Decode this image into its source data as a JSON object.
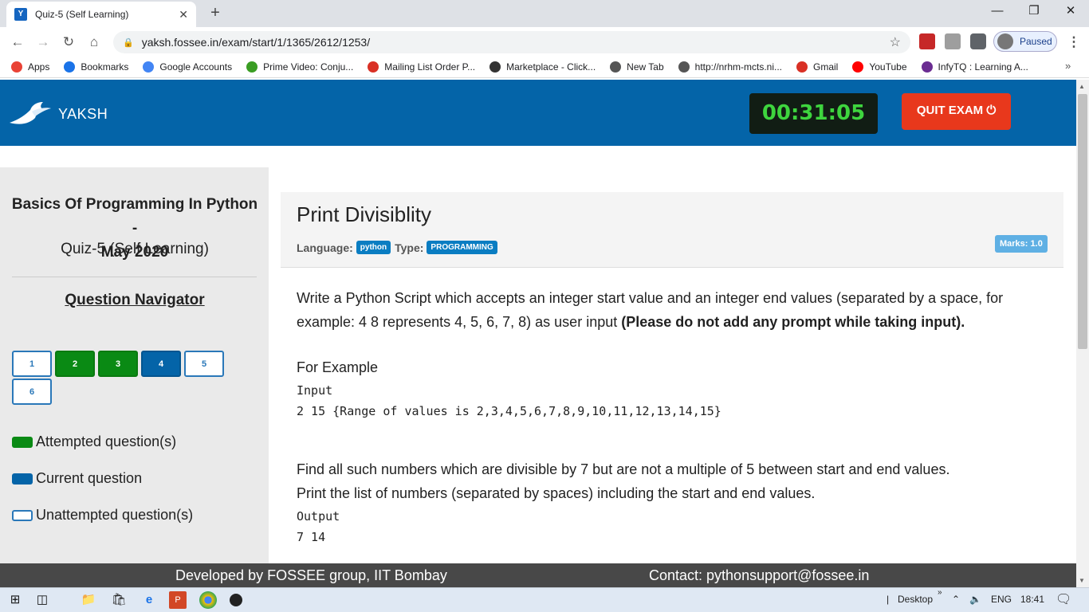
{
  "browser": {
    "tab_title": "Quiz-5 (Self Learning)",
    "tab_close": "✕",
    "new_tab": "+",
    "url": "yaksh.fossee.in/exam/start/1/1365/2612/1253/",
    "profile_status": "Paused",
    "bookmarks": [
      {
        "label": "Apps",
        "color": "#e94235"
      },
      {
        "label": "Bookmarks",
        "color": "#1a73e8"
      },
      {
        "label": "Google Accounts",
        "color": "#4285f4"
      },
      {
        "label": "Prime Video: Conju...",
        "color": "#3a9d23"
      },
      {
        "label": "Mailing List Order P...",
        "color": "#d93025"
      },
      {
        "label": "Marketplace - Click...",
        "color": "#333333"
      },
      {
        "label": "New Tab",
        "color": "#555555"
      },
      {
        "label": "http://nrhm-mcts.ni...",
        "color": "#555555"
      },
      {
        "label": "Gmail",
        "color": "#d93025"
      },
      {
        "label": "YouTube",
        "color": "#ff0000"
      },
      {
        "label": "InfyTQ : Learning A...",
        "color": "#6a2c91"
      }
    ]
  },
  "header": {
    "brand": "YAKSH",
    "timer": "00:31:05",
    "quit_label": "QUIT EXAM ⏻"
  },
  "sidebar": {
    "course_title_line1": "Basics Of Programming In Python -",
    "course_title_line2": "May 2020",
    "quiz_name": "Quiz-5 (Self Learning)",
    "navigator_title": "Question Navigator",
    "questions": [
      {
        "num": "1",
        "state": "unattempted"
      },
      {
        "num": "2",
        "state": "attempted"
      },
      {
        "num": "3",
        "state": "attempted"
      },
      {
        "num": "4",
        "state": "current"
      },
      {
        "num": "5",
        "state": "unattempted"
      },
      {
        "num": "6",
        "state": "unattempted"
      }
    ],
    "legend_attempted": "Attempted question(s)",
    "legend_current": "Current question",
    "legend_unattempted": "Unattempted question(s)"
  },
  "question": {
    "title": "Print Divisiblity",
    "language_label": "Language:",
    "language": "python",
    "type_label": "Type:",
    "type": "PROGRAMMING",
    "marks": "Marks: 1.0",
    "desc_plain": "Write a Python Script which accepts an integer start value and an integer end values (separated by a space, for example: 4 8 represents 4, 5, 6, 7, 8) as user input ",
    "desc_bold": "(Please do not add any prompt while taking input).",
    "example_heading": "For Example",
    "input_label": "Input",
    "input_example": "2 15 {Range of values is 2,3,4,5,6,7,8,9,10,11,12,13,14,15}",
    "find_text": "Find all such numbers which are divisible by 7 but are not a multiple of 5 between start and end values.",
    "print_text": "Print the list of numbers (separated by spaces) including the start and end values.",
    "output_label": "Output",
    "output_example": "7 14"
  },
  "footer": {
    "developed_by": "Developed by FOSSEE group, IIT Bombay",
    "contact": "Contact: pythonsupport@fossee.in"
  },
  "taskbar": {
    "desktop_label": "Desktop",
    "language": "ENG",
    "time": "18:41"
  },
  "colors": {
    "header_blue": "#0464a8",
    "attempted_green": "#0a8a14",
    "timer_green": "#3ed53e",
    "quit_red": "#e8381c"
  }
}
